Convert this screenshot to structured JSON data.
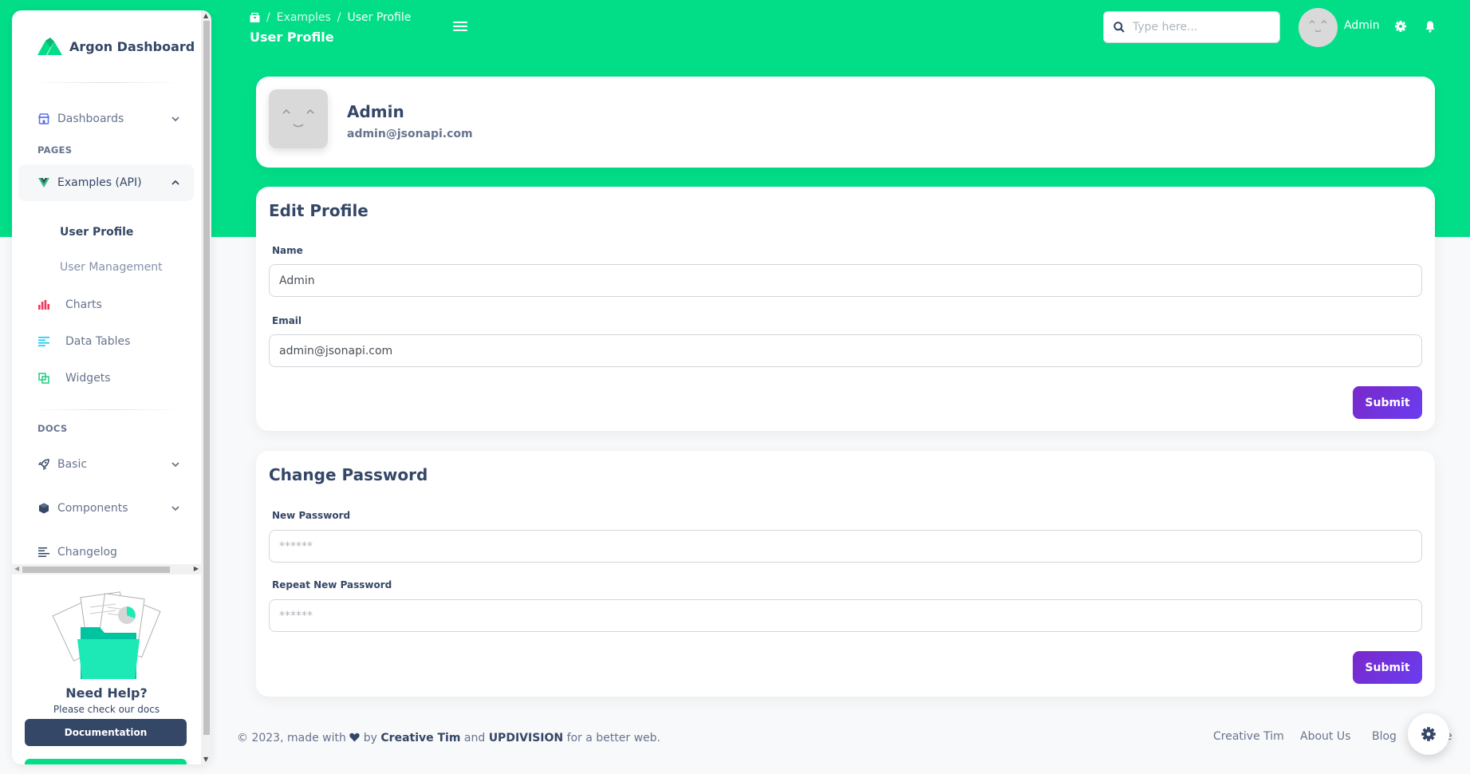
{
  "sidebar": {
    "brand": "Argon Dashboard",
    "items": [
      {
        "label": "Dashboards"
      },
      {
        "label": "Examples (API)"
      },
      {
        "label": "Charts"
      },
      {
        "label": "Data Tables"
      },
      {
        "label": "Widgets"
      },
      {
        "label": "Basic"
      },
      {
        "label": "Components"
      },
      {
        "label": "Changelog"
      }
    ],
    "sections": {
      "pages": "PAGES",
      "docs": "DOCS"
    },
    "sub_items": [
      {
        "label": "User Profile"
      },
      {
        "label": "User Management"
      }
    ],
    "help": {
      "title": "Need Help?",
      "subtitle": "Please check our docs",
      "button": "Documentation"
    }
  },
  "topbar": {
    "breadcrumb": [
      "Examples",
      "User Profile"
    ],
    "title": "User Profile",
    "search_placeholder": "Type here...",
    "user": "Admin"
  },
  "profile": {
    "name": "Admin",
    "email": "admin@jsonapi.com"
  },
  "edit_profile": {
    "title": "Edit Profile",
    "name_label": "Name",
    "name_value": "Admin",
    "email_label": "Email",
    "email_value": "admin@jsonapi.com",
    "submit": "Submit"
  },
  "change_password": {
    "title": "Change Password",
    "new_label": "New Password",
    "new_placeholder": "******",
    "repeat_label": "Repeat New Password",
    "repeat_placeholder": "******",
    "submit": "Submit"
  },
  "footer": {
    "copyright": "© 2023, made with",
    "by": "by",
    "author1": "Creative Tim",
    "and": "and",
    "author2": "UPDIVISION",
    "tail": "for a better web.",
    "links": [
      "Creative Tim",
      "About Us",
      "Blog",
      "e"
    ]
  },
  "colors": {
    "primary_green": "#02de88",
    "dark": "#344767",
    "submit_purple": "#7928ca"
  },
  "icons": [
    "home-icon",
    "menu-icon",
    "search-icon",
    "gear-icon",
    "bell-icon",
    "chevron-down-icon",
    "chevron-up-icon",
    "chart-bar-icon",
    "list-icon",
    "widgets-icon",
    "rocket-icon",
    "box-icon",
    "changelog-icon",
    "vue-icon",
    "shop-icon",
    "settings-icon"
  ]
}
